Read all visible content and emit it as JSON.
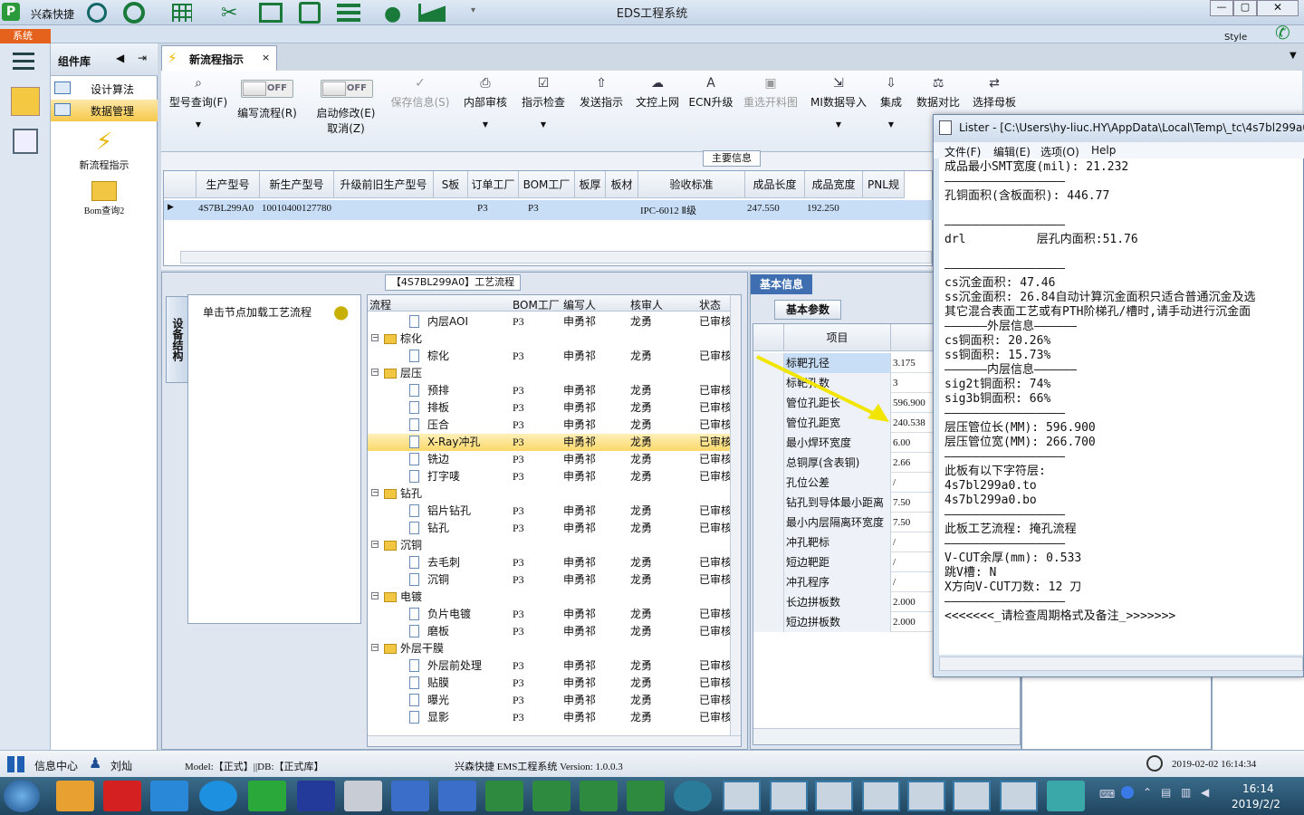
{
  "app": {
    "title": "EDS工程系统",
    "company": "兴森快捷",
    "style_label": "Style",
    "system_tab": "系统"
  },
  "left_nav": {
    "header": "组件库",
    "items": [
      {
        "label": "设计算法"
      },
      {
        "label": "数据管理"
      }
    ],
    "icons": [
      {
        "label": "新流程指示"
      },
      {
        "label": "Bom查询2"
      }
    ]
  },
  "doc_tab": {
    "label": "新流程指示"
  },
  "ribbon": {
    "buttons": [
      {
        "label": "型号查询(F)"
      },
      {
        "label": "编写流程(R)"
      },
      {
        "label": "启动修改(E)"
      },
      {
        "label": "取消(Z)"
      },
      {
        "label": "保存信息(S)"
      },
      {
        "label": "内部审核"
      },
      {
        "label": "指示检查"
      },
      {
        "label": "发送指示"
      },
      {
        "label": "文控上网"
      },
      {
        "label": "ECN升级"
      },
      {
        "label": "重选开料图"
      },
      {
        "label": "MI数据导入"
      },
      {
        "label": "集成"
      },
      {
        "label": "数据对比"
      },
      {
        "label": "选择母板"
      }
    ],
    "toggle_off": "OFF"
  },
  "main_info": {
    "title": "主要信息",
    "columns": [
      "生产型号",
      "新生产型号",
      "升级前旧生产型号",
      "S板",
      "订单工厂",
      "BOM工厂",
      "板厚",
      "板材",
      "验收标准",
      "成品长度",
      "成品宽度",
      "PNL规"
    ],
    "row": [
      "4S7BL299A0",
      "10010400127780",
      "",
      "",
      "P3",
      "P3",
      "",
      "",
      "IPC-6012 Ⅱ级",
      "247.550",
      "192.250",
      ""
    ]
  },
  "process": {
    "title": "【4S7BL299A0】工艺流程",
    "side_tab": "设备结构",
    "hint": "单击节点加载工艺流程",
    "columns": [
      "流程",
      "BOM工厂",
      "编写人",
      "核审人",
      "状态"
    ],
    "rows": [
      {
        "name": "内层AOI",
        "level": 2,
        "factory": "P3",
        "writer": "申勇祁",
        "reviewer": "龙勇",
        "status": "已审核"
      },
      {
        "name": "棕化",
        "level": 1,
        "factory": "",
        "writer": "",
        "reviewer": "",
        "status": ""
      },
      {
        "name": "棕化",
        "level": 2,
        "factory": "P3",
        "writer": "申勇祁",
        "reviewer": "龙勇",
        "status": "已审核"
      },
      {
        "name": "层压",
        "level": 1,
        "factory": "",
        "writer": "",
        "reviewer": "",
        "status": ""
      },
      {
        "name": "预排",
        "level": 2,
        "factory": "P3",
        "writer": "申勇祁",
        "reviewer": "龙勇",
        "status": "已审核"
      },
      {
        "name": "排板",
        "level": 2,
        "factory": "P3",
        "writer": "申勇祁",
        "reviewer": "龙勇",
        "status": "已审核"
      },
      {
        "name": "压合",
        "level": 2,
        "factory": "P3",
        "writer": "申勇祁",
        "reviewer": "龙勇",
        "status": "已审核"
      },
      {
        "name": "X-Ray冲孔",
        "level": 2,
        "factory": "P3",
        "writer": "申勇祁",
        "reviewer": "龙勇",
        "status": "已审核",
        "selected": true
      },
      {
        "name": "铣边",
        "level": 2,
        "factory": "P3",
        "writer": "申勇祁",
        "reviewer": "龙勇",
        "status": "已审核"
      },
      {
        "name": "打字唛",
        "level": 2,
        "factory": "P3",
        "writer": "申勇祁",
        "reviewer": "龙勇",
        "status": "已审核"
      },
      {
        "name": "钻孔",
        "level": 1,
        "factory": "",
        "writer": "",
        "reviewer": "",
        "status": ""
      },
      {
        "name": "铝片钻孔",
        "level": 2,
        "factory": "P3",
        "writer": "申勇祁",
        "reviewer": "龙勇",
        "status": "已审核"
      },
      {
        "name": "钻孔",
        "level": 2,
        "factory": "P3",
        "writer": "申勇祁",
        "reviewer": "龙勇",
        "status": "已审核"
      },
      {
        "name": "沉铜",
        "level": 1,
        "factory": "",
        "writer": "",
        "reviewer": "",
        "status": ""
      },
      {
        "name": "去毛刺",
        "level": 2,
        "factory": "P3",
        "writer": "申勇祁",
        "reviewer": "龙勇",
        "status": "已审核"
      },
      {
        "name": "沉铜",
        "level": 2,
        "factory": "P3",
        "writer": "申勇祁",
        "reviewer": "龙勇",
        "status": "已审核"
      },
      {
        "name": "电镀",
        "level": 1,
        "factory": "",
        "writer": "",
        "reviewer": "",
        "status": ""
      },
      {
        "name": "负片电镀",
        "level": 2,
        "factory": "P3",
        "writer": "申勇祁",
        "reviewer": "龙勇",
        "status": "已审核"
      },
      {
        "name": "磨板",
        "level": 2,
        "factory": "P3",
        "writer": "申勇祁",
        "reviewer": "龙勇",
        "status": "已审核"
      },
      {
        "name": "外层干膜",
        "level": 1,
        "factory": "",
        "writer": "",
        "reviewer": "",
        "status": ""
      },
      {
        "name": "外层前处理",
        "level": 2,
        "factory": "P3",
        "writer": "申勇祁",
        "reviewer": "龙勇",
        "status": "已审核"
      },
      {
        "name": "贴膜",
        "level": 2,
        "factory": "P3",
        "writer": "申勇祁",
        "reviewer": "龙勇",
        "status": "已审核"
      },
      {
        "name": "曝光",
        "level": 2,
        "factory": "P3",
        "writer": "申勇祁",
        "reviewer": "龙勇",
        "status": "已审核"
      },
      {
        "name": "显影",
        "level": 2,
        "factory": "P3",
        "writer": "申勇祁",
        "reviewer": "龙勇",
        "status": "已审核"
      }
    ]
  },
  "params": {
    "tab": "基本信息",
    "subtab": "基本参数",
    "col_item": "项目",
    "col_value": "参",
    "rows": [
      {
        "item": "标靶孔径",
        "value": "3.175"
      },
      {
        "item": "标靶孔数",
        "value": "3"
      },
      {
        "item": "管位孔距长",
        "value": "596.900"
      },
      {
        "item": "管位孔距宽",
        "value": "240.538"
      },
      {
        "item": "最小焊环宽度",
        "value": "6.00"
      },
      {
        "item": "总铜厚(含表铜)",
        "value": "2.66"
      },
      {
        "item": "孔位公差",
        "value": "/"
      },
      {
        "item": "钻孔到导体最小距离",
        "value": "7.50"
      },
      {
        "item": "最小内层隔离环宽度",
        "value": "7.50"
      },
      {
        "item": "冲孔靶标",
        "value": "/"
      },
      {
        "item": "短边靶距",
        "value": "/"
      },
      {
        "item": "冲孔程序",
        "value": "/"
      },
      {
        "item": "长边拼板数",
        "value": "2.000"
      },
      {
        "item": "短边拼板数",
        "value": "2.000"
      }
    ]
  },
  "lister": {
    "title": "Lister - [C:\\Users\\hy-liuc.HY\\AppData\\Local\\Temp\\_tc\\4s7bl299a0.",
    "menu": [
      "文件(F)",
      "编辑(E)",
      "选项(O)",
      "Help"
    ],
    "lines": [
      "成品最小SMT宽度(mil): 21.232",
      "—————————————————",
      "孔铜面积(含板面积): 446.77",
      "",
      "—————————————————",
      "drl          层孔内面积:51.76",
      "",
      "—————————————————",
      "cs沉金面积: 47.46",
      "ss沉金面积: 26.84自动计算沉金面积只适合普通沉金及选",
      "其它混合表面工艺或有PTH阶梯孔/槽时,请手动进行沉金面",
      "——————外层信息——————",
      "cs铜面积: 20.26%",
      "ss铜面积: 15.73%",
      "——————内层信息——————",
      "sig2t铜面积: 74%",
      "sig3b铜面积: 66%",
      "—————————————————",
      "层压管位长(MM): 596.900",
      "层压管位宽(MM): 266.700",
      "—————————————————",
      "此板有以下字符层:",
      "4s7bl299a0.to",
      "4s7bl299a0.bo",
      "—————————————————",
      "此板工艺流程: 掩孔流程",
      "—————————————————",
      "V-CUT余厚(mm): 0.533",
      "跳V槽: N",
      "X方向V-CUT刀数: 12 刀",
      "—————————————————",
      "<<<<<<<_请检查周期格式及备注_>>>>>>>"
    ]
  },
  "statusbar": {
    "info_center": "信息中心",
    "user": "刘灿",
    "model": "Model:【正式】||DB:【正式库】",
    "version": "兴森快捷  EMS工程系统  Version: 1.0.0.3",
    "datetime": "2019-02-02  16:14:34"
  },
  "taskbar": {
    "time": "16:14",
    "date": "2019/2/2"
  },
  "colors": {
    "accent": "#1e5fb4",
    "selected_row": "#fde28a",
    "arrow": "#f2e600"
  }
}
